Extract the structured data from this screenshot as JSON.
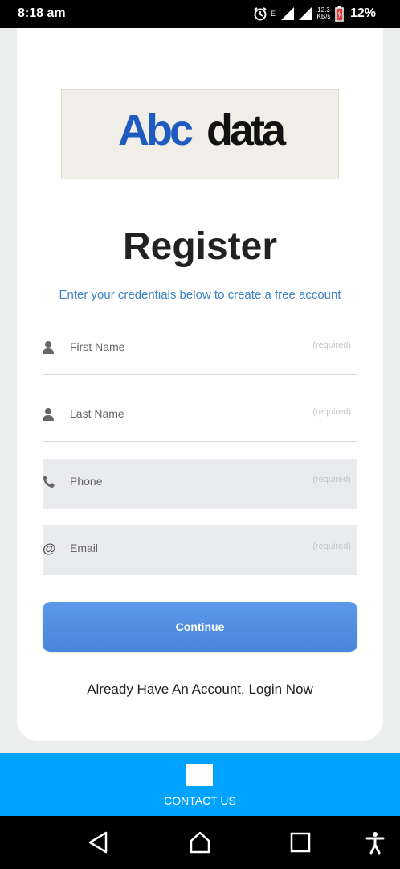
{
  "status_bar": {
    "time": "8:18 am",
    "net_speed_top": "12.3",
    "net_speed_bottom": "KB/s",
    "battery": "12%",
    "network_label": "E"
  },
  "brand": {
    "logo_text_a": "Abc",
    "logo_text_b": "data",
    "logo_color_a": "#1f5bbf",
    "logo_color_b": "#111111"
  },
  "page": {
    "title": "Register",
    "subtitle": "Enter your credentials below to create a free account"
  },
  "form": {
    "fields": [
      {
        "placeholder": "First Name",
        "hint": "(required)",
        "icon": "user-icon"
      },
      {
        "placeholder": "Last Name",
        "hint": "(required)",
        "icon": "user-icon"
      },
      {
        "placeholder": "Phone",
        "hint": "(required)",
        "icon": "phone-icon"
      },
      {
        "placeholder": "Email",
        "hint": "(required)",
        "icon": "at-icon"
      }
    ],
    "continue_label": "Continue",
    "login_link": "Already Have An Account, Login Now"
  },
  "contact": {
    "label": "CONTACT US"
  },
  "colors": {
    "accent": "#3e82c4",
    "button": "#4a86da",
    "contact_bar": "#00a2ff"
  }
}
